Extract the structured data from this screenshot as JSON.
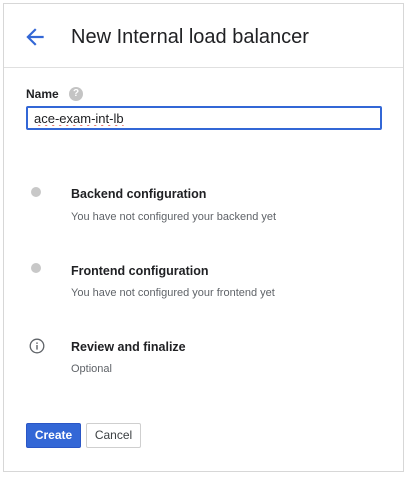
{
  "header": {
    "back_icon": "arrow-back-icon",
    "title": "New Internal load balancer"
  },
  "form": {
    "name_label": "Name",
    "help_icon": "help-circle-icon",
    "help_glyph": "?",
    "name_value": "ace-exam-int-lb"
  },
  "steps": [
    {
      "icon": "incomplete-step-dot-icon",
      "title": "Backend configuration",
      "subtitle": "You have not configured your backend yet"
    },
    {
      "icon": "incomplete-step-dot-icon",
      "title": "Frontend configuration",
      "subtitle": "You have not configured your frontend yet"
    },
    {
      "icon": "info-icon",
      "title": "Review and finalize",
      "subtitle": "Optional"
    }
  ],
  "actions": {
    "create_label": "Create",
    "cancel_label": "Cancel"
  },
  "colors": {
    "accent": "#3367d6",
    "back_arrow": "#3367d6",
    "step_dot": "#c8c8c8",
    "spellcheck_underline": "#d93025"
  }
}
